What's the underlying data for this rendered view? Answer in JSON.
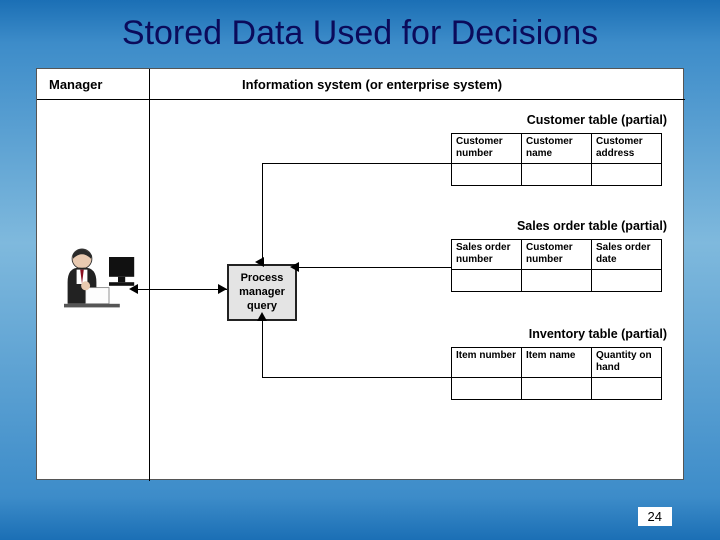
{
  "title": "Stored Data Used for Decisions",
  "page_number": "24",
  "headers": {
    "manager": "Manager",
    "info_system": "Information system (or enterprise system)"
  },
  "process_box": {
    "line1": "Process",
    "line2": "manager",
    "line3": "query"
  },
  "tables": {
    "customer": {
      "title": "Customer table (partial)",
      "cols": [
        "Customer number",
        "Customer name",
        "Customer address"
      ]
    },
    "sales": {
      "title": "Sales order table (partial)",
      "cols": [
        "Sales order number",
        "Customer number",
        "Sales order date"
      ]
    },
    "inventory": {
      "title": "Inventory table (partial)",
      "cols": [
        "Item number",
        "Item name",
        "Quantity on hand"
      ]
    }
  }
}
